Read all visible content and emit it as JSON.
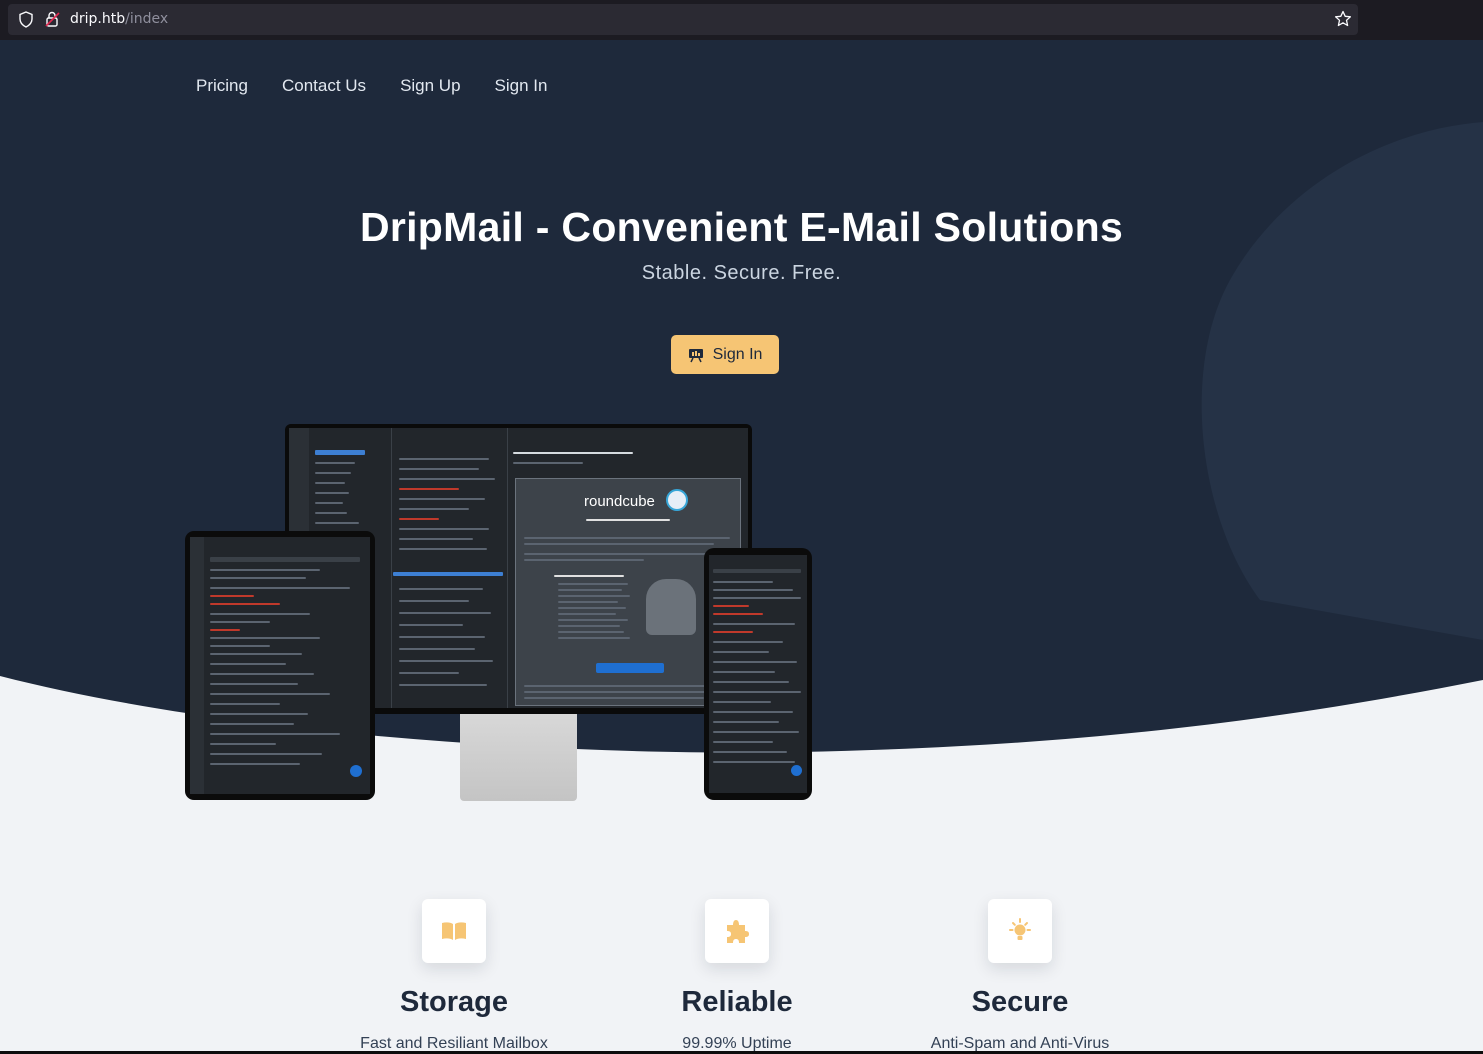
{
  "browser": {
    "url_host": "drip.htb",
    "url_path": "/index"
  },
  "nav": {
    "items": [
      "Pricing",
      "Contact Us",
      "Sign Up",
      "Sign In"
    ]
  },
  "hero": {
    "title": "DripMail - Convenient E-Mail Solutions",
    "subtitle": "Stable. Secure. Free.",
    "cta_label": "Sign In"
  },
  "preview": {
    "webmail_brand": "roundcube"
  },
  "features": [
    {
      "icon": "book-icon",
      "title": "Storage",
      "description": "Fast and Resiliant Mailbox"
    },
    {
      "icon": "puzzle-icon",
      "title": "Reliable",
      "description": "99.99% Uptime"
    },
    {
      "icon": "lightbulb-icon",
      "title": "Secure",
      "description": "Anti-Spam and Anti-Virus"
    }
  ],
  "colors": {
    "hero_bg": "#1e293b",
    "accent": "#f6c574",
    "page_bg": "#f1f3f6"
  }
}
